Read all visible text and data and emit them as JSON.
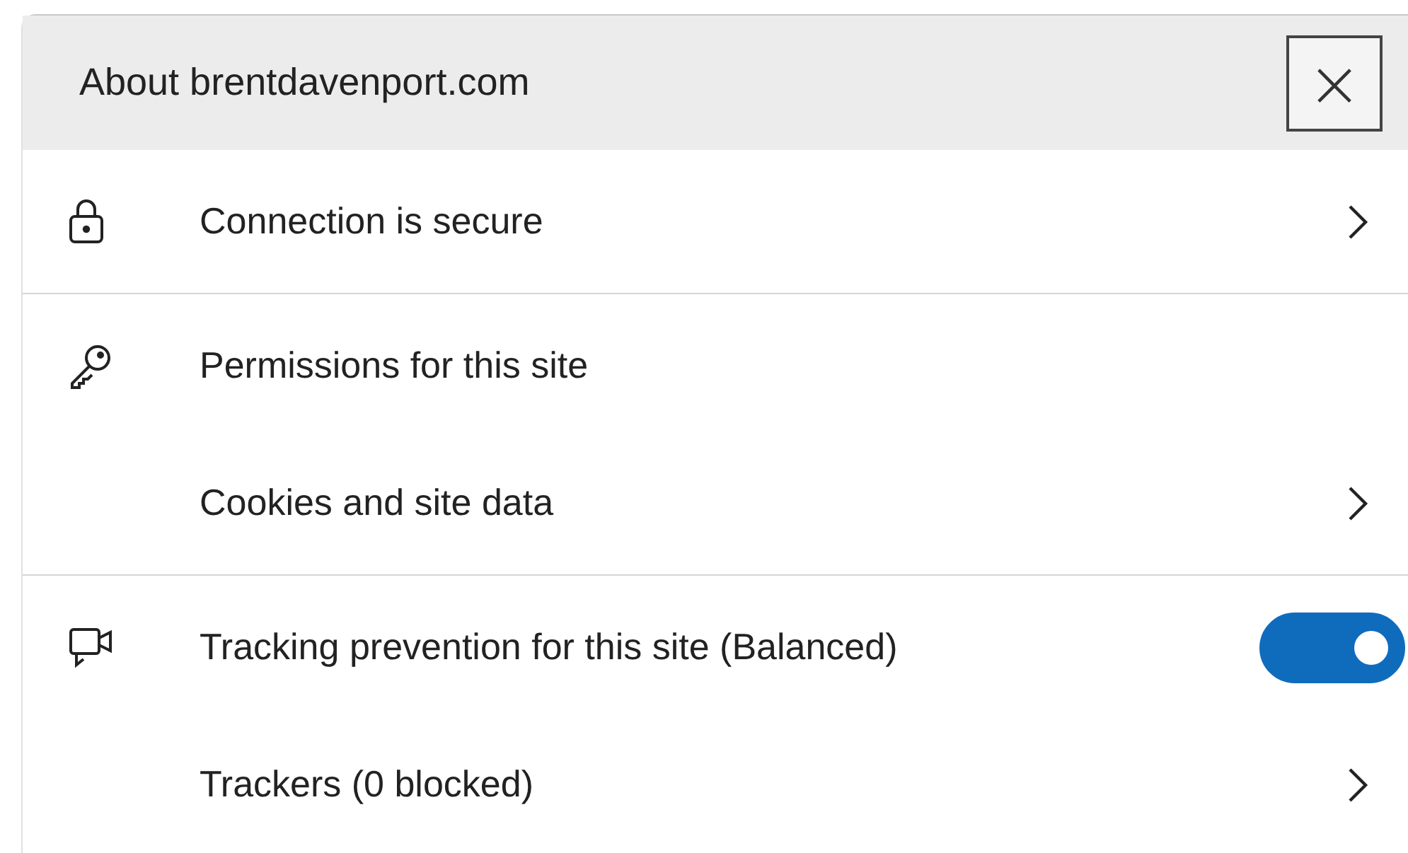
{
  "header": {
    "title": "About brentdavenport.com",
    "close_label": "×"
  },
  "sections": [
    {
      "rows": [
        {
          "kind": "link",
          "label": "Connection is secure"
        }
      ]
    },
    {
      "rows": [
        {
          "kind": "heading",
          "label": "Permissions for this site"
        },
        {
          "kind": "link",
          "label": "Cookies and site data"
        }
      ]
    },
    {
      "rows": [
        {
          "kind": "toggle",
          "label": "Tracking prevention for this site (Balanced)",
          "on": true
        },
        {
          "kind": "link",
          "label": "Trackers (0 blocked)"
        }
      ]
    }
  ]
}
